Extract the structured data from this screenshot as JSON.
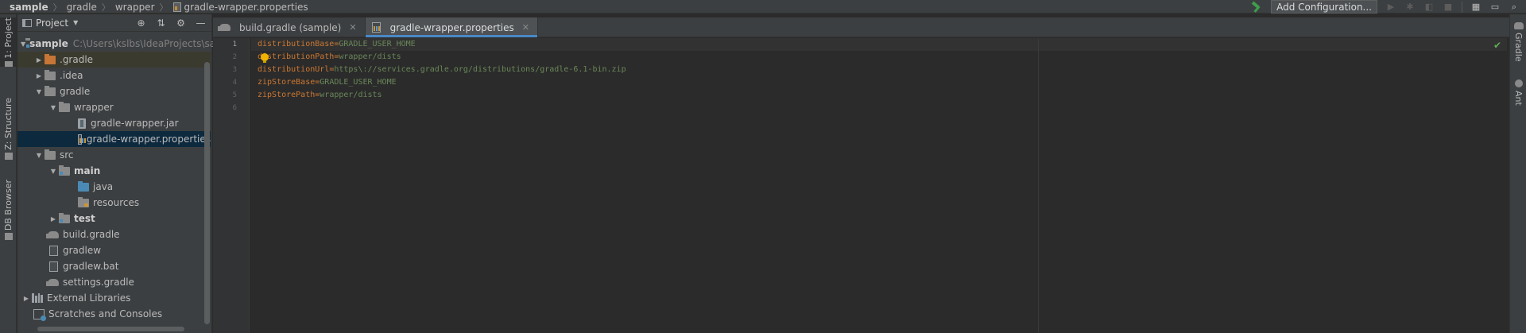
{
  "breadcrumbs": [
    "sample",
    "gradle",
    "wrapper",
    "gradle-wrapper.properties"
  ],
  "toolbar": {
    "add_configuration": "Add Configuration...",
    "icons": [
      "build-hammer-icon",
      "run-icon",
      "debug-icon",
      "coverage-icon",
      "stop-icon",
      "project-structure-icon",
      "sdk-icon",
      "search-everywhere-icon"
    ]
  },
  "left_strip": {
    "tabs": [
      {
        "label": "1: Project",
        "icon": "project-icon"
      },
      {
        "label": "Z: Structure",
        "icon": "structure-icon"
      },
      {
        "label": "DB Browser",
        "icon": "db-icon"
      }
    ]
  },
  "project_panel": {
    "title": "Project",
    "tools": [
      "locate-icon",
      "collapse-all-icon",
      "settings-gear-icon",
      "hide-icon"
    ],
    "tree": [
      {
        "label": "sample",
        "path": "C:\\Users\\kslbs\\IdeaProjects\\sample",
        "depth": 0,
        "expanded": true,
        "icon": "module-folder",
        "bold": true
      },
      {
        "label": ".gradle",
        "depth": 1,
        "expanded": false,
        "icon": "folder-orange",
        "highlight": true
      },
      {
        "label": ".idea",
        "depth": 1,
        "expanded": false,
        "icon": "folder"
      },
      {
        "label": "gradle",
        "depth": 1,
        "expanded": true,
        "icon": "folder"
      },
      {
        "label": "wrapper",
        "depth": 2,
        "expanded": true,
        "icon": "folder"
      },
      {
        "label": "gradle-wrapper.jar",
        "depth": 3,
        "icon": "jar"
      },
      {
        "label": "gradle-wrapper.properties",
        "depth": 3,
        "icon": "properties",
        "selected": true
      },
      {
        "label": "src",
        "depth": 1,
        "expanded": true,
        "icon": "folder"
      },
      {
        "label": "main",
        "depth": 2,
        "expanded": true,
        "icon": "folder",
        "bold": true
      },
      {
        "label": "java",
        "depth": 3,
        "icon": "folder-blue"
      },
      {
        "label": "resources",
        "depth": 3,
        "icon": "folder-resources"
      },
      {
        "label": "test",
        "depth": 2,
        "expanded": false,
        "icon": "folder",
        "bold": true
      },
      {
        "label": "build.gradle",
        "depth": 1,
        "icon": "gradle"
      },
      {
        "label": "gradlew",
        "depth": 1,
        "icon": "file"
      },
      {
        "label": "gradlew.bat",
        "depth": 1,
        "icon": "file"
      },
      {
        "label": "settings.gradle",
        "depth": 1,
        "icon": "gradle"
      },
      {
        "label": "External Libraries",
        "depth": 0,
        "expanded": false,
        "icon": "libraries"
      },
      {
        "label": "Scratches and Consoles",
        "depth": 0,
        "icon": "scratches"
      }
    ]
  },
  "tabs": [
    {
      "label": "build.gradle (sample)",
      "icon": "gradle-icon",
      "active": false
    },
    {
      "label": "gradle-wrapper.properties",
      "icon": "properties-file-icon",
      "active": true
    }
  ],
  "editor": {
    "lines": [
      {
        "n": "1",
        "key": "distributionBase",
        "value": "GRADLE_USER_HOME"
      },
      {
        "n": "2",
        "key": "distributionPath",
        "value": "wrapper/dists"
      },
      {
        "n": "3",
        "key": "distributionUrl",
        "value": "https\\://services.gradle.org/distributions/gradle-6.1-bin.zip"
      },
      {
        "n": "4",
        "key": "zipStoreBase",
        "value": "GRADLE_USER_HOME"
      },
      {
        "n": "5",
        "key": "zipStorePath",
        "value": "wrapper/dists"
      },
      {
        "n": "6",
        "key": "",
        "value": ""
      }
    ],
    "key_color": "#cc7832",
    "value_color": "#6a8759"
  },
  "right_strip": {
    "tabs": [
      {
        "label": "Gradle",
        "icon": "gradle-icon"
      },
      {
        "label": "Ant",
        "icon": "ant-icon"
      }
    ]
  },
  "colors": {
    "selection": "#0d293e",
    "accent_tab": "#4a88c7",
    "build_green": "#3f9d4d"
  }
}
